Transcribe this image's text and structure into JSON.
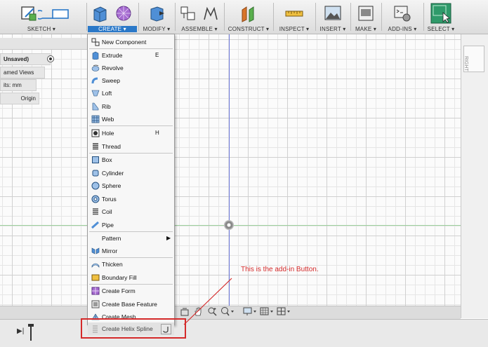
{
  "toolbar": {
    "groups": [
      {
        "label": "SKETCH ▾",
        "active": false
      },
      {
        "label": "CREATE ▾",
        "active": true
      },
      {
        "label": "MODIFY ▾",
        "active": false
      },
      {
        "label": "ASSEMBLE ▾",
        "active": false
      },
      {
        "label": "CONSTRUCT ▾",
        "active": false
      },
      {
        "label": "INSPECT ▾",
        "active": false
      },
      {
        "label": "INSERT ▾",
        "active": false
      },
      {
        "label": "MAKE ▾",
        "active": false
      },
      {
        "label": "ADD-INS ▾",
        "active": false
      },
      {
        "label": "SELECT ▾",
        "active": false
      }
    ]
  },
  "browser": {
    "document": "Unsaved)",
    "named_views": "amed Views",
    "units": "its: mm",
    "origin": "Origin"
  },
  "viewcube_label": "RIGHT",
  "menu": {
    "items": [
      {
        "label": "New Component",
        "key": "",
        "icon": "new-component-icon"
      },
      {
        "label": "Extrude",
        "key": "E",
        "icon": "extrude-icon"
      },
      {
        "label": "Revolve",
        "key": "",
        "icon": "revolve-icon"
      },
      {
        "label": "Sweep",
        "key": "",
        "icon": "sweep-icon"
      },
      {
        "label": "Loft",
        "key": "",
        "icon": "loft-icon"
      },
      {
        "label": "Rib",
        "key": "",
        "icon": "rib-icon"
      },
      {
        "label": "Web",
        "key": "",
        "icon": "web-icon"
      },
      {
        "label": "Hole",
        "key": "H",
        "icon": "hole-icon"
      },
      {
        "label": "Thread",
        "key": "",
        "icon": "thread-icon"
      },
      {
        "label": "Box",
        "key": "",
        "icon": "box-icon"
      },
      {
        "label": "Cylinder",
        "key": "",
        "icon": "cylinder-icon"
      },
      {
        "label": "Sphere",
        "key": "",
        "icon": "sphere-icon"
      },
      {
        "label": "Torus",
        "key": "",
        "icon": "torus-icon"
      },
      {
        "label": "Coil",
        "key": "",
        "icon": "coil-icon"
      },
      {
        "label": "Pipe",
        "key": "",
        "icon": "pipe-icon"
      },
      {
        "label": "Pattern",
        "key": "",
        "icon": ""
      },
      {
        "label": "Mirror",
        "key": "",
        "icon": "mirror-icon"
      },
      {
        "label": "Thicken",
        "key": "",
        "icon": "thicken-icon"
      },
      {
        "label": "Boundary Fill",
        "key": "",
        "icon": "boundary-fill-icon"
      },
      {
        "label": "Create Form",
        "key": "",
        "icon": "create-form-icon"
      },
      {
        "label": "Create Base Feature",
        "key": "",
        "icon": "base-feature-icon"
      },
      {
        "label": "Create Mesh",
        "key": "",
        "icon": "create-mesh-icon"
      },
      {
        "label": "Create Helix Spline",
        "key": "",
        "icon": "helix-spline-icon"
      }
    ]
  },
  "annotation": {
    "text": "This is the add-in Button.",
    "color": "#d42a2a"
  },
  "colors": {
    "accent": "#2a78c8",
    "axis_blue": "#6a76d8",
    "axis_green": "#9ccf9c"
  }
}
